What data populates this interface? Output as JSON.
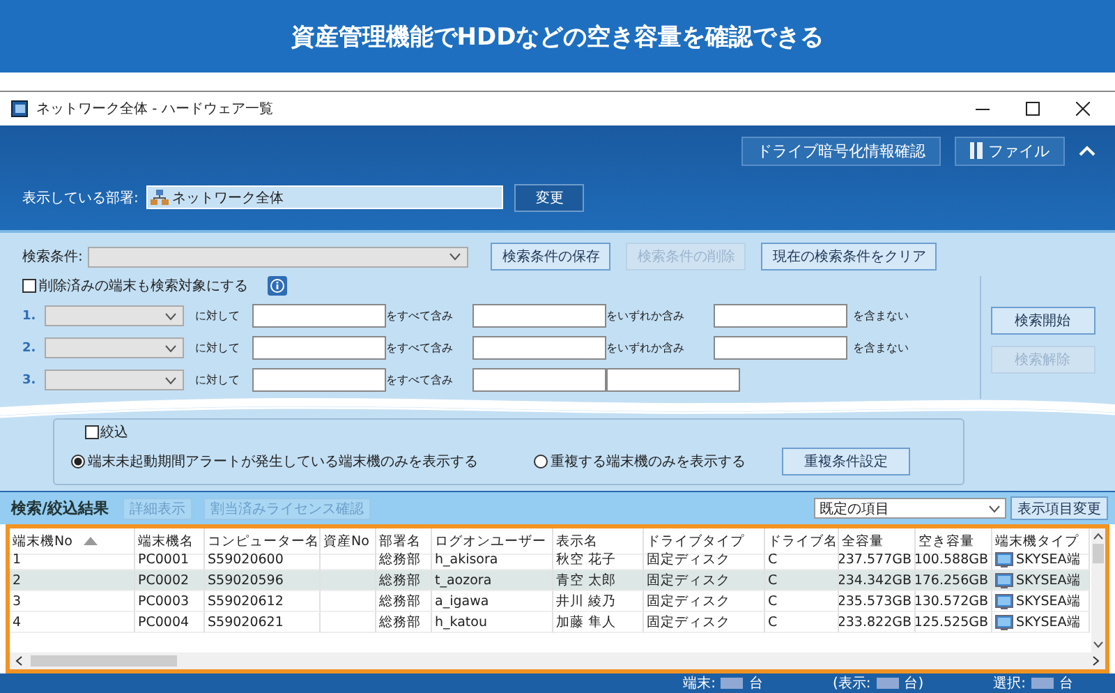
{
  "banner": {
    "title": "資産管理機能でHDDなどの空き容量を確認できる"
  },
  "window": {
    "title": "ネットワーク全体 - ハードウェア一覧",
    "header_buttons": [
      "ドライブ暗号化情報確認",
      "ファイル"
    ]
  },
  "department": {
    "label": "表示している部署:",
    "value": "ネットワーク全体",
    "button": "変更"
  },
  "search": {
    "label": "検索条件:",
    "buttons": [
      {
        "label": "検索条件の保存",
        "disabled": false
      },
      {
        "label": "検索条件の削除",
        "disabled": true
      },
      {
        "label": "現在の検索条件をクリア",
        "disabled": false
      }
    ],
    "include_deleted": {
      "label": "削除済みの端末も検索対象にする",
      "checked": false
    },
    "conditions": [
      {
        "number": "1.",
        "labels": [
          "に対して",
          "をすべて含み",
          "をいずれか含み",
          "を含まない"
        ]
      },
      {
        "number": "2.",
        "labels": [
          "に対して",
          "をすべて含み",
          "をいずれか含み",
          "を含まない"
        ]
      },
      {
        "number": "3.",
        "labels": [
          "に対して",
          "をすべて含み"
        ]
      }
    ],
    "side_buttons": [
      {
        "label": "検索開始",
        "disabled": false
      },
      {
        "label": "検索解除",
        "disabled": true
      }
    ]
  },
  "filter": {
    "label": "絞込",
    "checked": false,
    "radios": [
      {
        "label": "端末未起動期間アラートが発生している端末機のみを表示する",
        "selected": true
      },
      {
        "label": "重複する端末機のみを表示する",
        "selected": false
      }
    ],
    "button": "重複条件設定"
  },
  "results": {
    "title": "検索/絞込結果",
    "tabs": [
      {
        "label": "詳細表示",
        "disabled": true
      },
      {
        "label": "割当済みライセンス確認",
        "disabled": true
      }
    ],
    "select": "既定の項目",
    "button": "表示項目変更"
  },
  "table": {
    "columns": [
      {
        "label": "端末機No",
        "sorted": true
      },
      {
        "label": "端末機名",
        "sorted": false
      },
      {
        "label": "コンピューター名",
        "sorted": false
      },
      {
        "label": "資産No",
        "sorted": false
      },
      {
        "label": "部署名",
        "sorted": false
      },
      {
        "label": "ログオンユーザー",
        "sorted": false
      },
      {
        "label": "表示名",
        "sorted": false
      },
      {
        "label": "ドライブタイプ",
        "sorted": false
      },
      {
        "label": "ドライブ名",
        "sorted": false
      },
      {
        "label": "全容量",
        "sorted": false
      },
      {
        "label": "空き容量",
        "sorted": false
      },
      {
        "label": "端末機タイプ",
        "sorted": false
      }
    ],
    "rows": [
      {
        "selected": false,
        "cells": [
          "1",
          "PC0001",
          "S59020600",
          "",
          "総務部",
          "h_akisora",
          "秋空 花子",
          "固定ディスク",
          "C",
          "237.577GB",
          "100.588GB",
          "SKYSEA端"
        ]
      },
      {
        "selected": true,
        "cells": [
          "2",
          "PC0002",
          "S59020596",
          "",
          "総務部",
          "t_aozora",
          "青空 太郎",
          "固定ディスク",
          "C",
          "234.342GB",
          "176.256GB",
          "SKYSEA端"
        ]
      },
      {
        "selected": false,
        "cells": [
          "3",
          "PC0003",
          "S59020612",
          "",
          "総務部",
          "a_igawa",
          "井川 綾乃",
          "固定ディスク",
          "C",
          "235.573GB",
          "130.572GB",
          "SKYSEA端"
        ]
      },
      {
        "selected": false,
        "cells": [
          "4",
          "PC0004",
          "S59020621",
          "",
          "総務部",
          "h_katou",
          "加藤 隼人",
          "固定ディスク",
          "C",
          "233.822GB",
          "125.525GB",
          "SKYSEA端"
        ]
      }
    ]
  },
  "status_bar": [
    {
      "label": "端末:",
      "unit": "台"
    },
    {
      "label": "(表示:",
      "unit": "台)"
    },
    {
      "label": "選択:",
      "unit": "台"
    }
  ]
}
